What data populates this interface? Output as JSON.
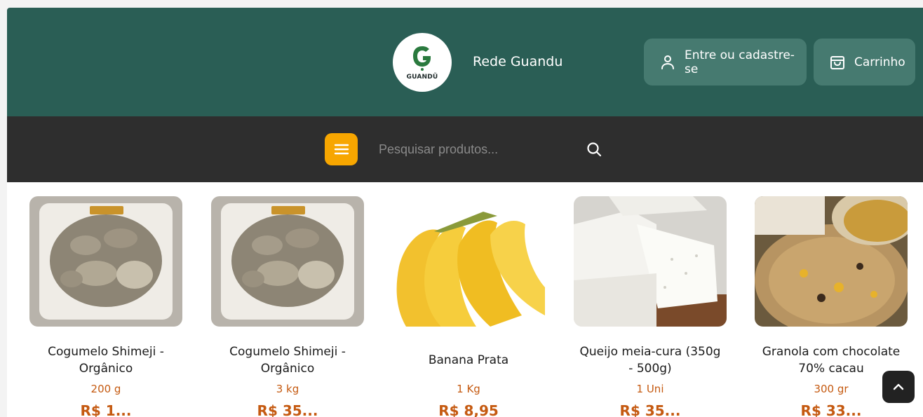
{
  "header": {
    "brand_name": "Rede Guandu",
    "logo_text": "GUANDŬ",
    "login_label": "Entre ou cadastre-se",
    "cart_label": "Carrinho"
  },
  "search": {
    "placeholder": "Pesquisar produtos..."
  },
  "colors": {
    "header_bg": "#2a5e55",
    "toolbar_bg": "#2e2e2e",
    "accent_orange": "#f7a600",
    "price_text": "#c55a11"
  },
  "icons": {
    "logo": "guandu-logo",
    "login": "user-icon",
    "cart": "shopping-bag-icon",
    "menu": "hamburger-menu-icon",
    "search": "search-icon",
    "back_to_top": "chevron-up-icon"
  },
  "products": [
    {
      "name": "Cogumelo Shimeji - Orgânico",
      "quantity": "200 g",
      "price": "R$ 1..."
    },
    {
      "name": "Cogumelo Shimeji - Orgânico",
      "quantity": "3 kg",
      "price": "R$ 35..."
    },
    {
      "name": "Banana Prata",
      "quantity": "1 Kg",
      "price": "R$ 8,95"
    },
    {
      "name": "Queijo meia-cura (350g - 500g)",
      "quantity": "1 Uni",
      "price": "R$ 35..."
    },
    {
      "name": "Granola com chocolate 70% cacau",
      "quantity": "300 gr",
      "price": "R$ 33..."
    }
  ]
}
